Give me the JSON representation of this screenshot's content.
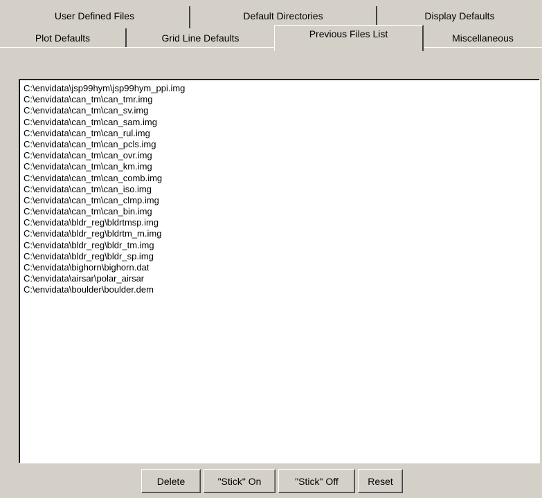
{
  "tabs": {
    "row1": [
      "User Defined Files",
      "Default Directories",
      "Display Defaults"
    ],
    "row2": [
      "Plot Defaults",
      "Grid Line Defaults",
      "Previous Files List",
      "Miscellaneous"
    ],
    "selected": "Previous Files List"
  },
  "files": [
    "C:\\envidata\\jsp99hym\\jsp99hym_ppi.img",
    "C:\\envidata\\can_tm\\can_tmr.img",
    "C:\\envidata\\can_tm\\can_sv.img",
    "C:\\envidata\\can_tm\\can_sam.img",
    "C:\\envidata\\can_tm\\can_rul.img",
    "C:\\envidata\\can_tm\\can_pcls.img",
    "C:\\envidata\\can_tm\\can_ovr.img",
    "C:\\envidata\\can_tm\\can_km.img",
    "C:\\envidata\\can_tm\\can_comb.img",
    "C:\\envidata\\can_tm\\can_iso.img",
    "C:\\envidata\\can_tm\\can_clmp.img",
    "C:\\envidata\\can_tm\\can_bin.img",
    "C:\\envidata\\bldr_reg\\bldrtmsp.img",
    "C:\\envidata\\bldr_reg\\bldrtm_m.img",
    "C:\\envidata\\bldr_reg\\bldr_tm.img",
    "C:\\envidata\\bldr_reg\\bldr_sp.img",
    "C:\\envidata\\bighorn\\bighorn.dat",
    "C:\\envidata\\airsar\\polar_airsar",
    "C:\\envidata\\boulder\\boulder.dem"
  ],
  "buttons": {
    "delete": "Delete",
    "stick_on": "\"Stick\" On",
    "stick_off": "\"Stick\" Off",
    "reset": "Reset"
  },
  "colors": {
    "face": "#d4d0c8",
    "list_background": "#ffffff",
    "shadow": "#404040",
    "highlight": "#ffffff"
  }
}
